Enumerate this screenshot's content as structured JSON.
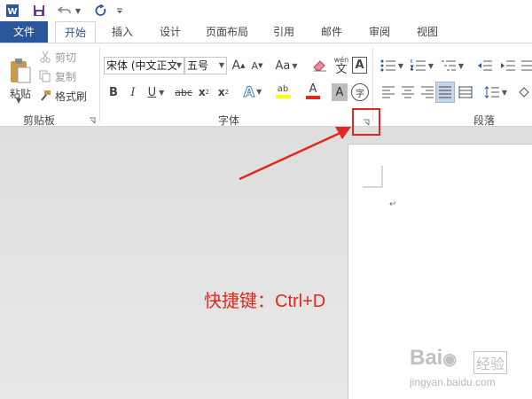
{
  "quick_access": {
    "app_icon": "word-icon",
    "save_icon": "save-icon",
    "undo_icon": "undo-icon",
    "redo_icon": "redo-icon",
    "customize_icon": "customize-icon"
  },
  "tabs": [
    {
      "label": "文件"
    },
    {
      "label": "开始"
    },
    {
      "label": "插入"
    },
    {
      "label": "设计"
    },
    {
      "label": "页面布局"
    },
    {
      "label": "引用"
    },
    {
      "label": "邮件"
    },
    {
      "label": "审阅"
    },
    {
      "label": "视图"
    }
  ],
  "clipboard": {
    "paste_label": "粘贴",
    "cut_label": "剪切",
    "copy_label": "复制",
    "format_painter_label": "格式刷",
    "group_label": "剪贴板"
  },
  "font": {
    "font_name": "宋体 (中文正文",
    "font_size": "五号",
    "grow_label": "A",
    "shrink_label": "A",
    "change_case_label": "Aa",
    "phonetic_label": "wén",
    "phonetic_char": "文",
    "border_char": "A",
    "bold_label": "B",
    "italic_label": "I",
    "underline_label": "U",
    "strike_label": "abc",
    "subscript_label": "x",
    "subscript_sub": "2",
    "superscript_label": "x",
    "superscript_sup": "2",
    "effects_label": "A",
    "highlight_label": "ab",
    "font_color_label": "A",
    "shading_label": "A",
    "enclose_label": "字",
    "group_label": "字体"
  },
  "paragraph": {
    "group_label": "段落"
  },
  "document": {
    "paragraph_mark": "↵"
  },
  "annotation": {
    "shortcut_text": "快捷键：Ctrl+D"
  },
  "watermark": {
    "brand": "Bai",
    "brand_suffix": "经验",
    "url": "jingyan.baidu.com"
  },
  "colors": {
    "file_tab": "#2b579a",
    "accent": "#2b579a",
    "annotation_red": "#e0281e"
  }
}
